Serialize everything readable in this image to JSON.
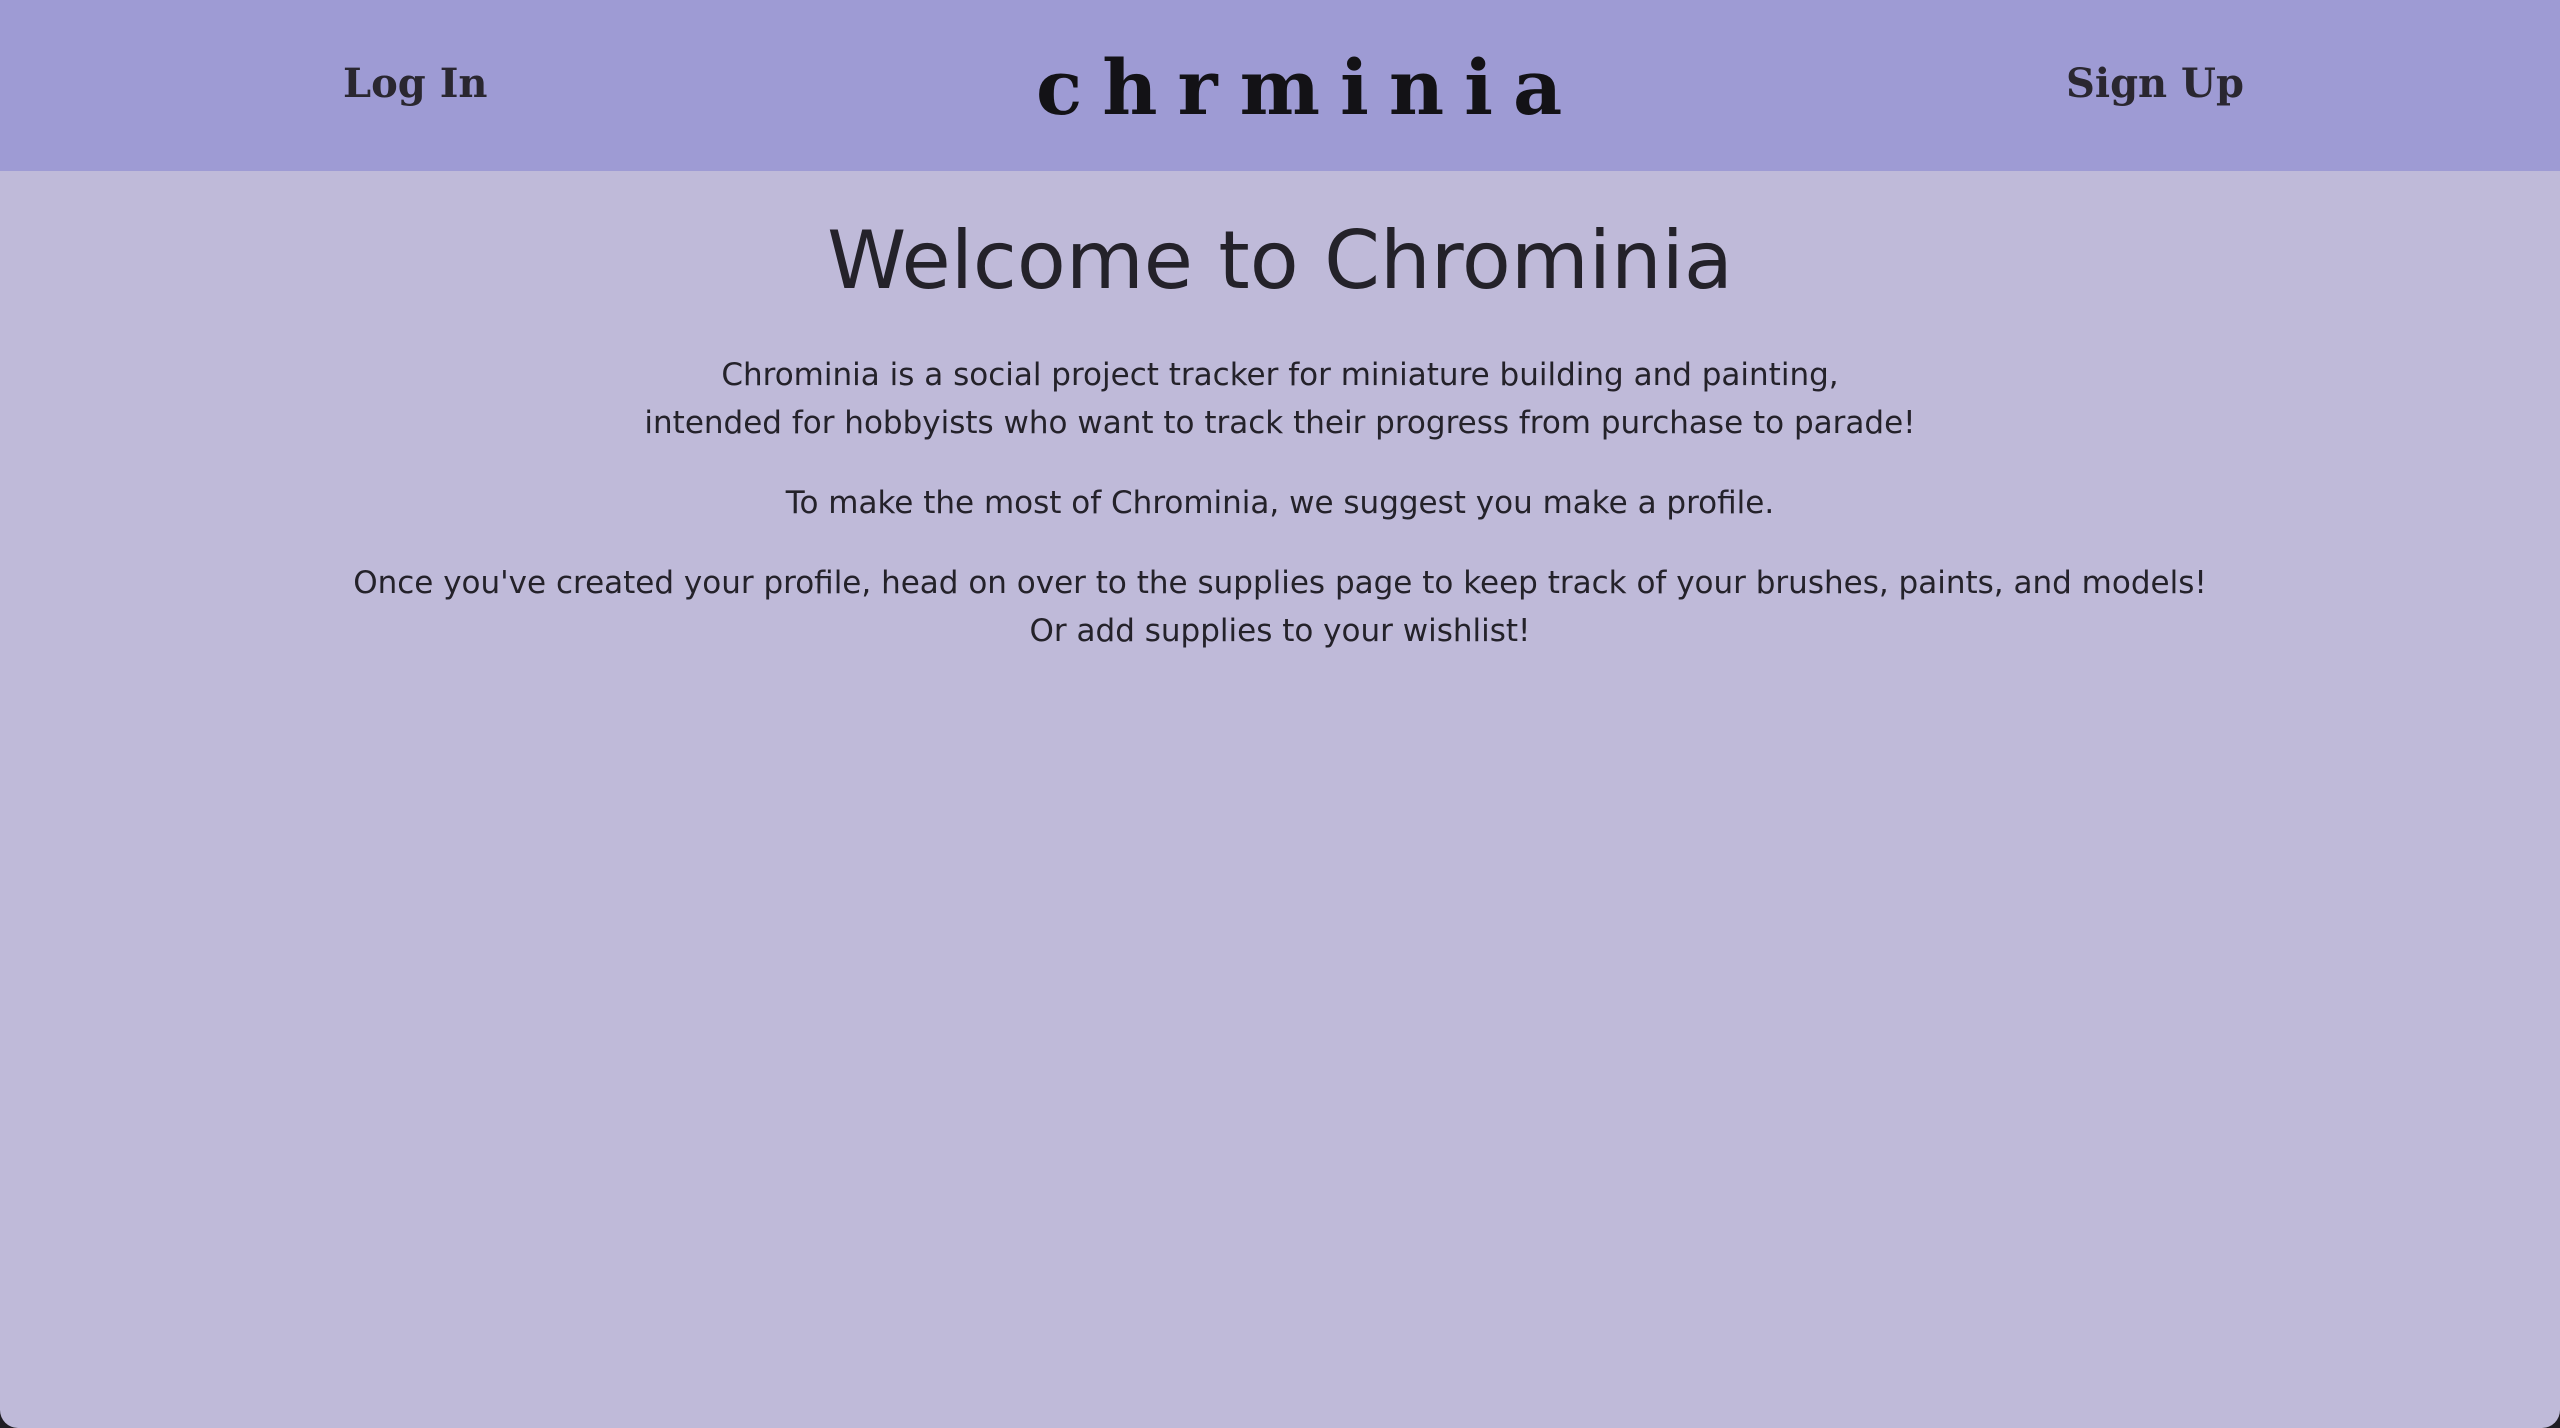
{
  "navbar": {
    "login_label": "Log In",
    "signup_label": "Sign Up",
    "logo": {
      "text_before": "chr",
      "text_after": "minia",
      "orb_icon": "color-wheel-icon"
    },
    "background_color": "#9e9bd4"
  },
  "main": {
    "title": "Welcome to Chrominia",
    "intro": [
      "Chrominia is a social project tracker for miniature building and painting,",
      "intended for hobbyists who want to track their progress from purchase to parade!"
    ],
    "suggestion": "To make the most of Chrominia, we suggest you make a profile.",
    "supplies": [
      "Once you've created your profile, head on over to the supplies page to keep track of your brushes, paints, and models!",
      "Or add supplies to your wishlist!"
    ],
    "background_color": "#bfbad9"
  }
}
